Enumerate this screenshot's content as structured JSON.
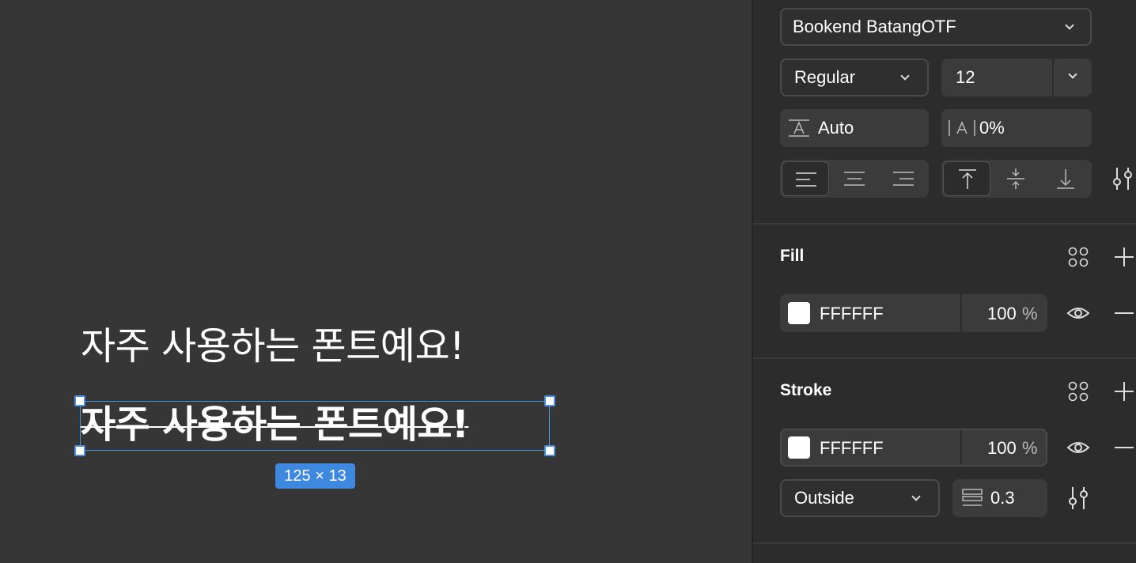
{
  "canvas": {
    "text_plain": "자주 사용하는 폰트예요!",
    "text_selected": "자주 사용하는 폰트예요!",
    "dimension_badge": "125 × 13",
    "selection_color": "#4a90e2"
  },
  "typography": {
    "font_family": "Bookend BatangOTF",
    "font_weight": "Regular",
    "font_size": "12",
    "line_height": "Auto",
    "letter_spacing": "0%",
    "text_align_options": [
      "align-left-icon",
      "align-center-icon",
      "align-right-icon"
    ],
    "text_align_selected": "align-left-icon",
    "vertical_align_options": [
      "align-top-icon",
      "align-middle-icon",
      "align-bottom-icon"
    ],
    "vertical_align_selected": "align-top-icon"
  },
  "fill": {
    "title": "Fill",
    "color_hex": "FFFFFF",
    "opacity": "100",
    "percent": "%"
  },
  "stroke": {
    "title": "Stroke",
    "color_hex": "FFFFFF",
    "opacity": "100",
    "percent": "%",
    "position": "Outside",
    "weight": "0.3"
  }
}
